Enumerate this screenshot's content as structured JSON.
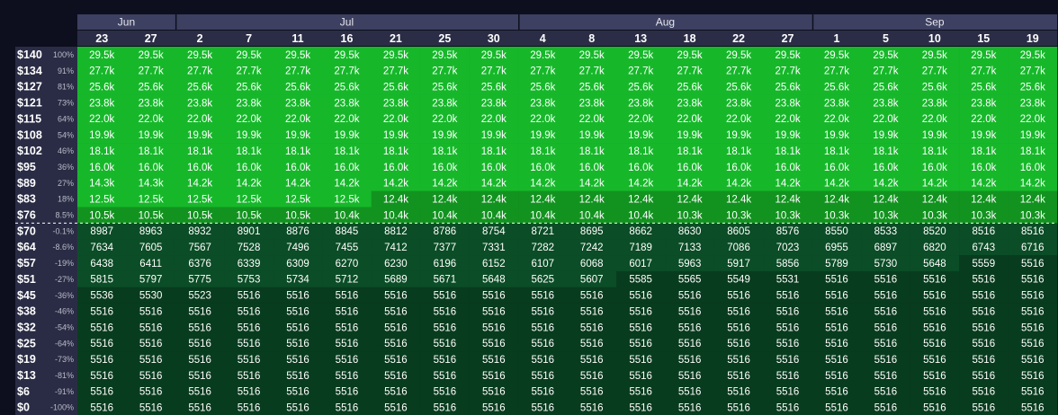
{
  "chart_data": {
    "type": "heatmap",
    "months": [
      {
        "label": "Jun",
        "span": 2
      },
      {
        "label": "Jul",
        "span": 7
      },
      {
        "label": "Aug",
        "span": 6
      },
      {
        "label": "Sep",
        "span": 5
      }
    ],
    "dates": [
      "23",
      "27",
      "2",
      "7",
      "11",
      "16",
      "21",
      "25",
      "30",
      "4",
      "8",
      "13",
      "18",
      "22",
      "27",
      "1",
      "5",
      "10",
      "15",
      "19"
    ],
    "prices": [
      "$140",
      "$134",
      "$127",
      "$121",
      "$115",
      "$108",
      "$102",
      "$95",
      "$89",
      "$83",
      "$76",
      "$70",
      "$64",
      "$57",
      "$51",
      "$45",
      "$38",
      "$32",
      "$25",
      "$19",
      "$13",
      "$6",
      "$0"
    ],
    "pct_changes": [
      "100%",
      "91%",
      "81%",
      "73%",
      "64%",
      "54%",
      "46%",
      "36%",
      "27%",
      "18%",
      "8.5%",
      "-0.1%",
      "-8.6%",
      "-19%",
      "-27%",
      "-36%",
      "-46%",
      "-54%",
      "-64%",
      "-73%",
      "-81%",
      "-91%",
      "-100%"
    ],
    "values": [
      [
        "29.5k",
        "29.5k",
        "29.5k",
        "29.5k",
        "29.5k",
        "29.5k",
        "29.5k",
        "29.5k",
        "29.5k",
        "29.5k",
        "29.5k",
        "29.5k",
        "29.5k",
        "29.5k",
        "29.5k",
        "29.5k",
        "29.5k",
        "29.5k",
        "29.5k",
        "29.5k"
      ],
      [
        "27.7k",
        "27.7k",
        "27.7k",
        "27.7k",
        "27.7k",
        "27.7k",
        "27.7k",
        "27.7k",
        "27.7k",
        "27.7k",
        "27.7k",
        "27.7k",
        "27.7k",
        "27.7k",
        "27.7k",
        "27.7k",
        "27.7k",
        "27.7k",
        "27.7k",
        "27.7k"
      ],
      [
        "25.6k",
        "25.6k",
        "25.6k",
        "25.6k",
        "25.6k",
        "25.6k",
        "25.6k",
        "25.6k",
        "25.6k",
        "25.6k",
        "25.6k",
        "25.6k",
        "25.6k",
        "25.6k",
        "25.6k",
        "25.6k",
        "25.6k",
        "25.6k",
        "25.6k",
        "25.6k"
      ],
      [
        "23.8k",
        "23.8k",
        "23.8k",
        "23.8k",
        "23.8k",
        "23.8k",
        "23.8k",
        "23.8k",
        "23.8k",
        "23.8k",
        "23.8k",
        "23.8k",
        "23.8k",
        "23.8k",
        "23.8k",
        "23.8k",
        "23.8k",
        "23.8k",
        "23.8k",
        "23.8k"
      ],
      [
        "22.0k",
        "22.0k",
        "22.0k",
        "22.0k",
        "22.0k",
        "22.0k",
        "22.0k",
        "22.0k",
        "22.0k",
        "22.0k",
        "22.0k",
        "22.0k",
        "22.0k",
        "22.0k",
        "22.0k",
        "22.0k",
        "22.0k",
        "22.0k",
        "22.0k",
        "22.0k"
      ],
      [
        "19.9k",
        "19.9k",
        "19.9k",
        "19.9k",
        "19.9k",
        "19.9k",
        "19.9k",
        "19.9k",
        "19.9k",
        "19.9k",
        "19.9k",
        "19.9k",
        "19.9k",
        "19.9k",
        "19.9k",
        "19.9k",
        "19.9k",
        "19.9k",
        "19.9k",
        "19.9k"
      ],
      [
        "18.1k",
        "18.1k",
        "18.1k",
        "18.1k",
        "18.1k",
        "18.1k",
        "18.1k",
        "18.1k",
        "18.1k",
        "18.1k",
        "18.1k",
        "18.1k",
        "18.1k",
        "18.1k",
        "18.1k",
        "18.1k",
        "18.1k",
        "18.1k",
        "18.1k",
        "18.1k"
      ],
      [
        "16.0k",
        "16.0k",
        "16.0k",
        "16.0k",
        "16.0k",
        "16.0k",
        "16.0k",
        "16.0k",
        "16.0k",
        "16.0k",
        "16.0k",
        "16.0k",
        "16.0k",
        "16.0k",
        "16.0k",
        "16.0k",
        "16.0k",
        "16.0k",
        "16.0k",
        "16.0k"
      ],
      [
        "14.3k",
        "14.3k",
        "14.2k",
        "14.2k",
        "14.2k",
        "14.2k",
        "14.2k",
        "14.2k",
        "14.2k",
        "14.2k",
        "14.2k",
        "14.2k",
        "14.2k",
        "14.2k",
        "14.2k",
        "14.2k",
        "14.2k",
        "14.2k",
        "14.2k",
        "14.2k"
      ],
      [
        "12.5k",
        "12.5k",
        "12.5k",
        "12.5k",
        "12.5k",
        "12.5k",
        "12.4k",
        "12.4k",
        "12.4k",
        "12.4k",
        "12.4k",
        "12.4k",
        "12.4k",
        "12.4k",
        "12.4k",
        "12.4k",
        "12.4k",
        "12.4k",
        "12.4k",
        "12.4k"
      ],
      [
        "10.5k",
        "10.5k",
        "10.5k",
        "10.5k",
        "10.5k",
        "10.4k",
        "10.4k",
        "10.4k",
        "10.4k",
        "10.4k",
        "10.4k",
        "10.4k",
        "10.3k",
        "10.3k",
        "10.3k",
        "10.3k",
        "10.3k",
        "10.3k",
        "10.3k",
        "10.3k"
      ],
      [
        "8987",
        "8963",
        "8932",
        "8901",
        "8876",
        "8845",
        "8812",
        "8786",
        "8754",
        "8721",
        "8695",
        "8662",
        "8630",
        "8605",
        "8576",
        "8550",
        "8533",
        "8520",
        "8516",
        "8516"
      ],
      [
        "7634",
        "7605",
        "7567",
        "7528",
        "7496",
        "7455",
        "7412",
        "7377",
        "7331",
        "7282",
        "7242",
        "7189",
        "7133",
        "7086",
        "7023",
        "6955",
        "6897",
        "6820",
        "6743",
        "6716"
      ],
      [
        "6438",
        "6411",
        "6376",
        "6339",
        "6309",
        "6270",
        "6230",
        "6196",
        "6152",
        "6107",
        "6068",
        "6017",
        "5963",
        "5917",
        "5856",
        "5789",
        "5730",
        "5648",
        "5559",
        "5516"
      ],
      [
        "5815",
        "5797",
        "5775",
        "5753",
        "5734",
        "5712",
        "5689",
        "5671",
        "5648",
        "5625",
        "5607",
        "5585",
        "5565",
        "5549",
        "5531",
        "5516",
        "5516",
        "5516",
        "5516",
        "5516"
      ],
      [
        "5536",
        "5530",
        "5523",
        "5516",
        "5516",
        "5516",
        "5516",
        "5516",
        "5516",
        "5516",
        "5516",
        "5516",
        "5516",
        "5516",
        "5516",
        "5516",
        "5516",
        "5516",
        "5516",
        "5516"
      ],
      [
        "5516",
        "5516",
        "5516",
        "5516",
        "5516",
        "5516",
        "5516",
        "5516",
        "5516",
        "5516",
        "5516",
        "5516",
        "5516",
        "5516",
        "5516",
        "5516",
        "5516",
        "5516",
        "5516",
        "5516"
      ],
      [
        "5516",
        "5516",
        "5516",
        "5516",
        "5516",
        "5516",
        "5516",
        "5516",
        "5516",
        "5516",
        "5516",
        "5516",
        "5516",
        "5516",
        "5516",
        "5516",
        "5516",
        "5516",
        "5516",
        "5516"
      ],
      [
        "5516",
        "5516",
        "5516",
        "5516",
        "5516",
        "5516",
        "5516",
        "5516",
        "5516",
        "5516",
        "5516",
        "5516",
        "5516",
        "5516",
        "5516",
        "5516",
        "5516",
        "5516",
        "5516",
        "5516"
      ],
      [
        "5516",
        "5516",
        "5516",
        "5516",
        "5516",
        "5516",
        "5516",
        "5516",
        "5516",
        "5516",
        "5516",
        "5516",
        "5516",
        "5516",
        "5516",
        "5516",
        "5516",
        "5516",
        "5516",
        "5516"
      ],
      [
        "5516",
        "5516",
        "5516",
        "5516",
        "5516",
        "5516",
        "5516",
        "5516",
        "5516",
        "5516",
        "5516",
        "5516",
        "5516",
        "5516",
        "5516",
        "5516",
        "5516",
        "5516",
        "5516",
        "5516"
      ],
      [
        "5516",
        "5516",
        "5516",
        "5516",
        "5516",
        "5516",
        "5516",
        "5516",
        "5516",
        "5516",
        "5516",
        "5516",
        "5516",
        "5516",
        "5516",
        "5516",
        "5516",
        "5516",
        "5516",
        "5516"
      ],
      [
        "5516",
        "5516",
        "5516",
        "5516",
        "5516",
        "5516",
        "5516",
        "5516",
        "5516",
        "5516",
        "5516",
        "5516",
        "5516",
        "5516",
        "5516",
        "5516",
        "5516",
        "5516",
        "5516",
        "5516"
      ]
    ],
    "current_price_divider_after_row": "$76",
    "colors": {
      "background": "#0d0f1f",
      "header_bg": "#3d4060",
      "header_bg_dark": "#2b2d46",
      "row_label_bg": "#2a2c45",
      "profit_bright": "#16b82a",
      "profit_mid": "#12931f",
      "loss": "#0b4d26",
      "loss_dark": "#083c1e",
      "cell_text": "#ffffff",
      "pct_text": "#b9bbc9"
    }
  }
}
